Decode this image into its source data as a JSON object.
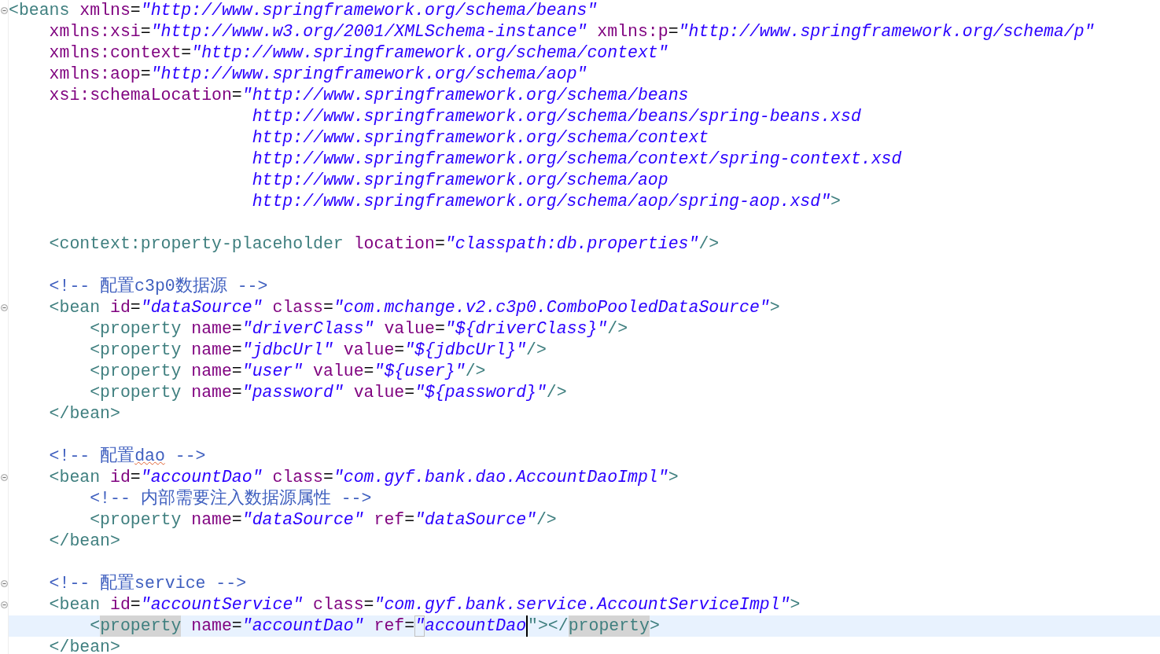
{
  "editor": {
    "lines": [
      {
        "fold": true,
        "tokens": [
          {
            "kind": "tag",
            "text": "<beans"
          },
          {
            "kind": "attr",
            "text": " xmlns"
          },
          {
            "kind": "eq",
            "text": "="
          },
          {
            "kind": "value",
            "text": "\"http://www.springframework.org/schema/beans\""
          }
        ]
      },
      {
        "tokens": [
          {
            "kind": "attr",
            "text": "    xmlns:xsi"
          },
          {
            "kind": "eq",
            "text": "="
          },
          {
            "kind": "value",
            "text": "\"http://www.w3.org/2001/XMLSchema-instance\""
          },
          {
            "kind": "attr",
            "text": " xmlns:p"
          },
          {
            "kind": "eq",
            "text": "="
          },
          {
            "kind": "value",
            "text": "\"http://www.springframework.org/schema/p\""
          }
        ]
      },
      {
        "tokens": [
          {
            "kind": "attr",
            "text": "    xmlns:context"
          },
          {
            "kind": "eq",
            "text": "="
          },
          {
            "kind": "value",
            "text": "\"http://www.springframework.org/schema/context\""
          }
        ]
      },
      {
        "tokens": [
          {
            "kind": "attr",
            "text": "    xmlns:aop"
          },
          {
            "kind": "eq",
            "text": "="
          },
          {
            "kind": "value",
            "text": "\"http://www.springframework.org/schema/aop\""
          }
        ]
      },
      {
        "tokens": [
          {
            "kind": "attr",
            "text": "    xsi:schemaLocation"
          },
          {
            "kind": "eq",
            "text": "="
          },
          {
            "kind": "value",
            "text": "\"http://www.springframework.org/schema/beans"
          }
        ]
      },
      {
        "tokens": [
          {
            "kind": "value",
            "text": "                        http://www.springframework.org/schema/beans/spring-beans.xsd"
          }
        ]
      },
      {
        "tokens": [
          {
            "kind": "value",
            "text": "                        http://www.springframework.org/schema/context"
          }
        ]
      },
      {
        "tokens": [
          {
            "kind": "value",
            "text": "                        http://www.springframework.org/schema/context/spring-context.xsd"
          }
        ]
      },
      {
        "tokens": [
          {
            "kind": "value",
            "text": "                        http://www.springframework.org/schema/aop"
          }
        ]
      },
      {
        "tokens": [
          {
            "kind": "value",
            "text": "                        http://www.springframework.org/schema/aop/spring-aop.xsd\""
          },
          {
            "kind": "tag",
            "text": ">"
          }
        ]
      },
      {
        "gap_before": true,
        "tokens": [
          {
            "kind": "tag",
            "text": "    <context:property-placeholder"
          },
          {
            "kind": "attr",
            "text": " location"
          },
          {
            "kind": "eq",
            "text": "="
          },
          {
            "kind": "value",
            "text": "\"classpath:db.properties\""
          },
          {
            "kind": "tag",
            "text": "/>"
          }
        ]
      },
      {
        "gap_before": true,
        "tokens": [
          {
            "kind": "comment",
            "text": "    <!-- 配置c3p0数据源 -->"
          }
        ]
      },
      {
        "fold": true,
        "tokens": [
          {
            "kind": "tag",
            "text": "    <bean"
          },
          {
            "kind": "attr",
            "text": " id"
          },
          {
            "kind": "eq",
            "text": "="
          },
          {
            "kind": "value",
            "text": "\"dataSource\""
          },
          {
            "kind": "attr",
            "text": " class"
          },
          {
            "kind": "eq",
            "text": "="
          },
          {
            "kind": "value",
            "text": "\"com.mchange.v2.c3p0.ComboPooledDataSource\""
          },
          {
            "kind": "tag",
            "text": ">"
          }
        ]
      },
      {
        "tokens": [
          {
            "kind": "tag",
            "text": "        <property"
          },
          {
            "kind": "attr",
            "text": " name"
          },
          {
            "kind": "eq",
            "text": "="
          },
          {
            "kind": "value",
            "text": "\"driverClass\""
          },
          {
            "kind": "attr",
            "text": " value"
          },
          {
            "kind": "eq",
            "text": "="
          },
          {
            "kind": "value",
            "text": "\"${driverClass}\""
          },
          {
            "kind": "tag",
            "text": "/>"
          }
        ]
      },
      {
        "tokens": [
          {
            "kind": "tag",
            "text": "        <property"
          },
          {
            "kind": "attr",
            "text": " name"
          },
          {
            "kind": "eq",
            "text": "="
          },
          {
            "kind": "value",
            "text": "\"jdbcUrl\""
          },
          {
            "kind": "attr",
            "text": " value"
          },
          {
            "kind": "eq",
            "text": "="
          },
          {
            "kind": "value",
            "text": "\"${jdbcUrl}\""
          },
          {
            "kind": "tag",
            "text": "/>"
          }
        ]
      },
      {
        "tokens": [
          {
            "kind": "tag",
            "text": "        <property"
          },
          {
            "kind": "attr",
            "text": " name"
          },
          {
            "kind": "eq",
            "text": "="
          },
          {
            "kind": "value",
            "text": "\"user\""
          },
          {
            "kind": "attr",
            "text": " value"
          },
          {
            "kind": "eq",
            "text": "="
          },
          {
            "kind": "value",
            "text": "\"${user}\""
          },
          {
            "kind": "tag",
            "text": "/>"
          }
        ]
      },
      {
        "tokens": [
          {
            "kind": "tag",
            "text": "        <property"
          },
          {
            "kind": "attr",
            "text": " name"
          },
          {
            "kind": "eq",
            "text": "="
          },
          {
            "kind": "value",
            "text": "\"password\""
          },
          {
            "kind": "attr",
            "text": " value"
          },
          {
            "kind": "eq",
            "text": "="
          },
          {
            "kind": "value",
            "text": "\"${password}\""
          },
          {
            "kind": "tag",
            "text": "/>"
          }
        ]
      },
      {
        "tokens": [
          {
            "kind": "tag",
            "text": "    </bean>"
          }
        ]
      },
      {
        "gap_before": true,
        "tokens": [
          {
            "kind": "comment",
            "text": "    <!-- 配置"
          },
          {
            "kind": "comment",
            "text": "dao",
            "spelling_error": true
          },
          {
            "kind": "comment",
            "text": " -->"
          }
        ]
      },
      {
        "fold": true,
        "tokens": [
          {
            "kind": "tag",
            "text": "    <bean"
          },
          {
            "kind": "attr",
            "text": " id"
          },
          {
            "kind": "eq",
            "text": "="
          },
          {
            "kind": "value",
            "text": "\"accountDao\""
          },
          {
            "kind": "attr",
            "text": " class"
          },
          {
            "kind": "eq",
            "text": "="
          },
          {
            "kind": "value",
            "text": "\"com.gyf.bank.dao.AccountDaoImpl\""
          },
          {
            "kind": "tag",
            "text": ">"
          }
        ]
      },
      {
        "tokens": [
          {
            "kind": "comment",
            "text": "        <!-- 内部需要注入数据源属性 -->"
          }
        ]
      },
      {
        "tokens": [
          {
            "kind": "tag",
            "text": "        <property"
          },
          {
            "kind": "attr",
            "text": " name"
          },
          {
            "kind": "eq",
            "text": "="
          },
          {
            "kind": "value",
            "text": "\"dataSource\""
          },
          {
            "kind": "attr",
            "text": " ref"
          },
          {
            "kind": "eq",
            "text": "="
          },
          {
            "kind": "value",
            "text": "\"dataSource\""
          },
          {
            "kind": "tag",
            "text": "/>"
          }
        ]
      },
      {
        "tokens": [
          {
            "kind": "tag",
            "text": "    </bean>"
          }
        ]
      },
      {
        "fold": true,
        "gap_before": true,
        "tokens": [
          {
            "kind": "comment",
            "text": "    <!-- 配置service -->"
          }
        ]
      },
      {
        "fold": true,
        "tokens": [
          {
            "kind": "tag",
            "text": "    <bean"
          },
          {
            "kind": "attr",
            "text": " id"
          },
          {
            "kind": "eq",
            "text": "="
          },
          {
            "kind": "value",
            "text": "\"accountService\""
          },
          {
            "kind": "attr",
            "text": " class"
          },
          {
            "kind": "eq",
            "text": "="
          },
          {
            "kind": "value",
            "text": "\"com.gyf.bank.service.AccountServiceImpl\""
          },
          {
            "kind": "tag",
            "text": ">"
          }
        ]
      },
      {
        "current": true,
        "tokens": [
          {
            "kind": "tag",
            "text": "        <"
          },
          {
            "kind": "tag",
            "text": "property",
            "matched": true
          },
          {
            "kind": "attr",
            "text": " name"
          },
          {
            "kind": "eq",
            "text": "="
          },
          {
            "kind": "value",
            "text": "\"accountDao\""
          },
          {
            "kind": "attr",
            "text": " ref"
          },
          {
            "kind": "eq",
            "text": "="
          },
          {
            "kind": "value",
            "text": "\"",
            "bracket_box": true
          },
          {
            "kind": "value",
            "text": "accountDao",
            "caret_after": true
          },
          {
            "kind": "tag",
            "text": "\"></"
          },
          {
            "kind": "tag",
            "text": "property",
            "matched": true
          },
          {
            "kind": "tag",
            "text": ">"
          }
        ]
      },
      {
        "tokens": [
          {
            "kind": "tag",
            "text": "    </bean>"
          }
        ]
      }
    ]
  }
}
